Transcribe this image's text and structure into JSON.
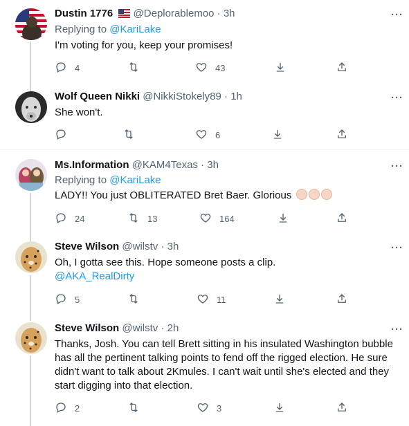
{
  "tweets": [
    {
      "name": "Dustin 1776",
      "handle": "@Deplorablemoo",
      "time": "3h",
      "flag": "us-flag-icon",
      "reply_prefix": "Replying to ",
      "reply_handle": "@KariLake",
      "text": "I'm voting for you, keep your promises!",
      "replies": "4",
      "retweets": "",
      "likes": "43"
    },
    {
      "name": "Wolf Queen Nikki",
      "handle": "@NikkiStokely89",
      "time": "1h",
      "text": "She won't.",
      "replies": "",
      "retweets": "",
      "likes": "6"
    },
    {
      "name": "Ms.Information",
      "handle": "@KAM4Texas",
      "time": "3h",
      "reply_prefix": "Replying to ",
      "reply_handle": "@KariLake",
      "text": "LADY!! You just OBLITERATED Bret Baer. Glorious",
      "emoji": "clapping-hands-icon",
      "replies": "24",
      "retweets": "13",
      "likes": "164"
    },
    {
      "name": "Steve Wilson",
      "handle": "@wilstv",
      "time": "3h",
      "text": "Oh, I gotta see this. Hope someone posts a clip.",
      "mention": "@AKA_RealDirty",
      "replies": "5",
      "retweets": "",
      "likes": "11"
    },
    {
      "name": "Steve Wilson",
      "handle": "@wilstv",
      "time": "2h",
      "text": "Thanks, Josh. You can tell Brett sitting in his insulated Washington bubble has all the pertinent talking points to fend off the rigged election. He sure didn't want to talk about 2Kmules. I can't wait until she's elected and they start digging into that election.",
      "replies": "2",
      "retweets": "",
      "likes": "3"
    }
  ],
  "separator": "·",
  "more_glyph": "···",
  "colors": {
    "link": "#1d9bf0",
    "muted": "#536471",
    "text": "#0f1419",
    "divider": "#eff3f4",
    "thread": "#cfd9de"
  }
}
